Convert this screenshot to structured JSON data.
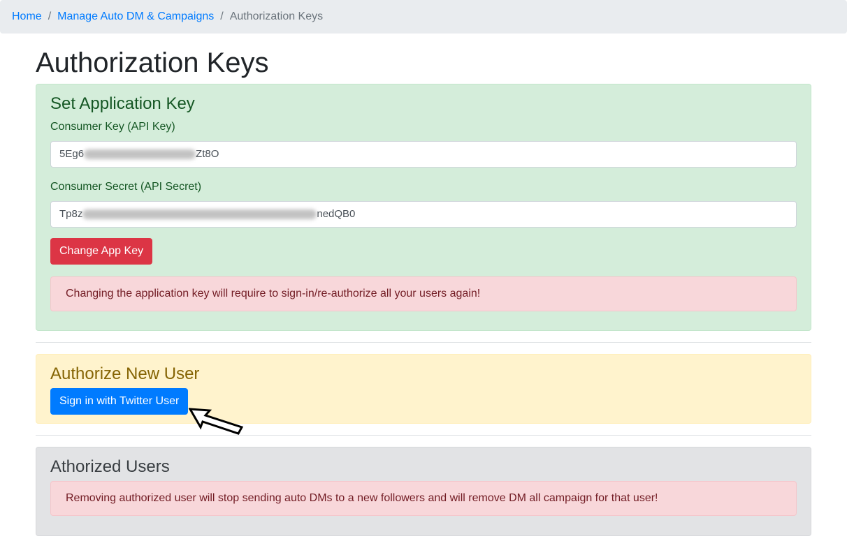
{
  "breadcrumb": {
    "home": "Home",
    "section": "Manage Auto DM & Campaigns",
    "current": "Authorization Keys",
    "separator": "/"
  },
  "page_title": "Authorization Keys",
  "app_key": {
    "heading": "Set Application Key",
    "consumer_key_label": "Consumer Key (API Key)",
    "consumer_key_prefix": "5Eg6",
    "consumer_key_suffix": "Zt8O",
    "consumer_secret_label": "Consumer Secret (API Secret)",
    "consumer_secret_prefix": "Tp8z",
    "consumer_secret_suffix": "nedQB0",
    "change_button": "Change App Key",
    "warning": "Changing the application key will require to sign-in/re-authorize all your users again!"
  },
  "authorize": {
    "heading": "Authorize New User",
    "sign_in_button": "Sign in with Twitter User"
  },
  "authorized_users": {
    "heading": "Athorized Users",
    "warning": "Removing authorized user will stop sending auto DMs to a new followers and will remove DM all campaign for that user!"
  },
  "colors": {
    "primary": "#007bff",
    "danger": "#dc3545",
    "success_bg": "#d4edda",
    "warning_bg": "#fff3cd",
    "secondary_bg": "#e2e3e5"
  },
  "icons": {
    "pointer": "outlined-arrow-pointer-icon"
  }
}
